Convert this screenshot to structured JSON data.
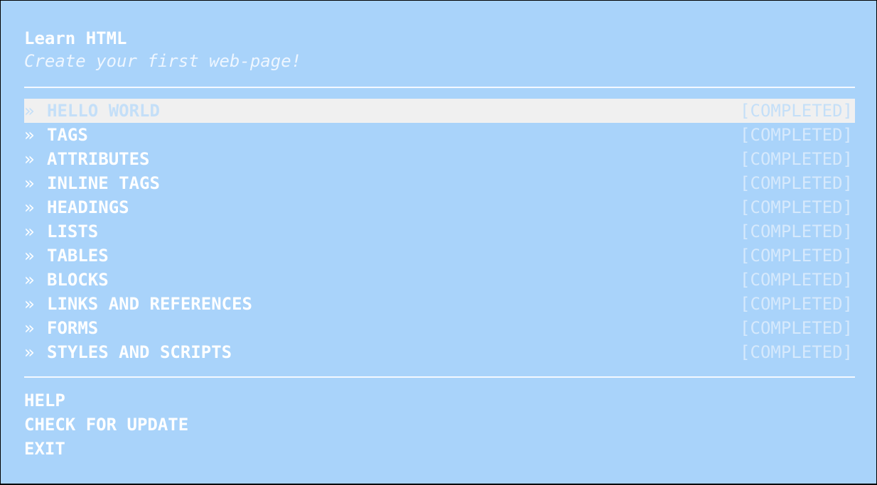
{
  "header": {
    "title": "Learn HTML",
    "subtitle": "Create your first web-page!"
  },
  "lessons": [
    {
      "chevron": "»",
      "label": "HELLO WORLD",
      "status": "[COMPLETED]",
      "selected": true
    },
    {
      "chevron": "»",
      "label": "TAGS",
      "status": "[COMPLETED]"
    },
    {
      "chevron": "»",
      "label": "ATTRIBUTES",
      "status": "[COMPLETED]"
    },
    {
      "chevron": "»",
      "label": "INLINE TAGS",
      "status": "[COMPLETED]"
    },
    {
      "chevron": "»",
      "label": "HEADINGS",
      "status": "[COMPLETED]"
    },
    {
      "chevron": "»",
      "label": "LISTS",
      "status": "[COMPLETED]"
    },
    {
      "chevron": "»",
      "label": "TABLES",
      "status": "[COMPLETED]"
    },
    {
      "chevron": "»",
      "label": "BLOCKS",
      "status": "[COMPLETED]"
    },
    {
      "chevron": "»",
      "label": "LINKS AND REFERENCES",
      "status": "[COMPLETED]"
    },
    {
      "chevron": "»",
      "label": "FORMS",
      "status": "[COMPLETED]"
    },
    {
      "chevron": "»",
      "label": "STYLES AND SCRIPTS",
      "status": "[COMPLETED]"
    }
  ],
  "menu": {
    "help": "HELP",
    "check_update": "CHECK FOR UPDATE",
    "exit": "EXIT"
  },
  "colors": {
    "background": "#a9d3fa",
    "text": "#ffffff",
    "status_text": "#d6e9fc",
    "selection_bg": "#f0f0f0",
    "selection_text": "#c4dff8"
  }
}
